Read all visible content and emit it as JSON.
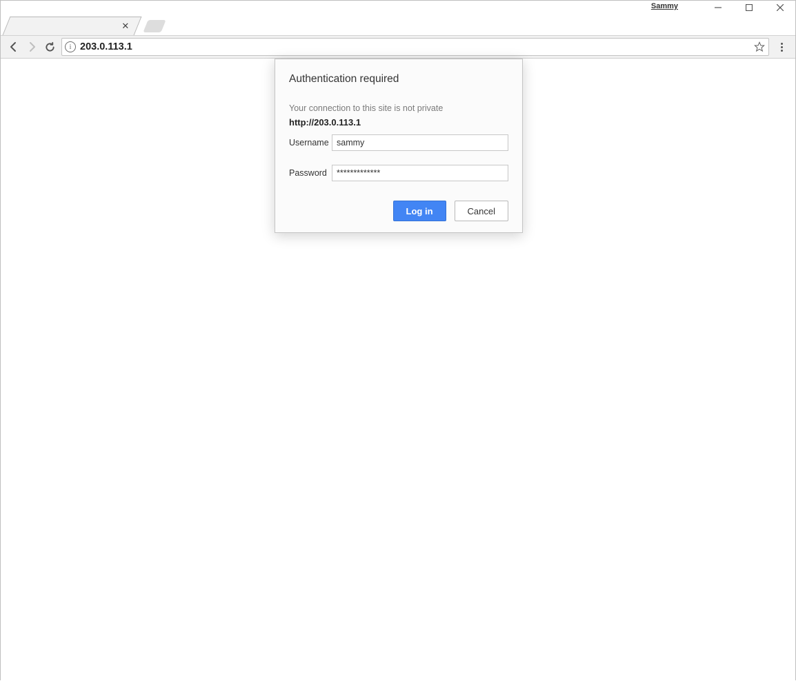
{
  "window": {
    "user_label": "Sammy"
  },
  "tab": {
    "title": ""
  },
  "address_bar": {
    "url": "203.0.113.1"
  },
  "dialog": {
    "title": "Authentication required",
    "warning": "Your connection to this site is not private",
    "site": "http://203.0.113.1",
    "username_label": "Username",
    "username_value": "sammy",
    "password_label": "Password",
    "password_value": "*************",
    "login_label": "Log in",
    "cancel_label": "Cancel"
  }
}
